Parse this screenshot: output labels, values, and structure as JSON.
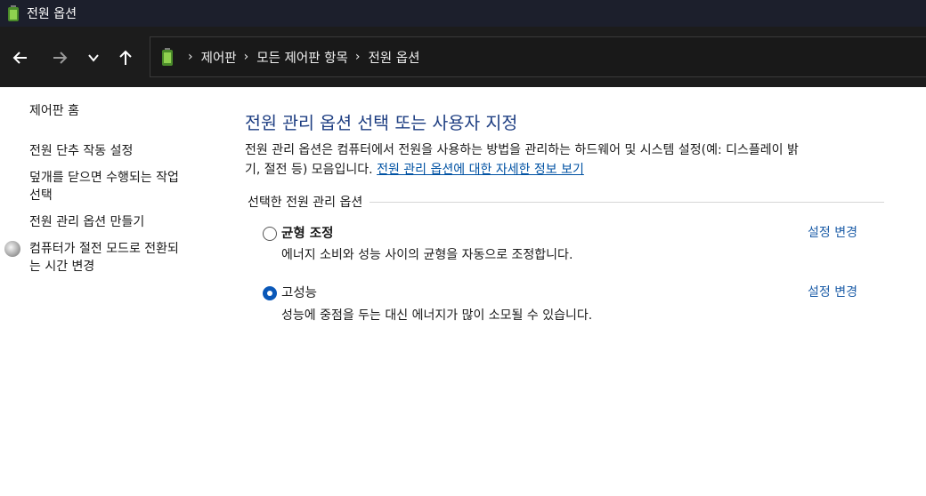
{
  "window": {
    "title": "전원 옵션",
    "icon": "battery-power-icon"
  },
  "nav": {
    "back": "back-arrow-icon",
    "forward": "forward-arrow-icon",
    "recent": "chevron-down-icon",
    "up": "up-arrow-icon"
  },
  "breadcrumb": {
    "sep": "›",
    "items": [
      "제어판",
      "모든 제어판 항목",
      "전원 옵션"
    ]
  },
  "sidebar": {
    "home": "제어판 홈",
    "links": [
      "전원 단추 작동 설정",
      "덮개를 닫으면 수행되는 작업",
      "선택",
      "전원 관리 옵션 만들기",
      "컴퓨터가 절전 모드로 전환되",
      "는 시간 변경"
    ]
  },
  "main": {
    "title": "전원 관리 옵션 선택 또는 사용자 지정",
    "description_line1": "전원 관리 옵션은 컴퓨터에서 전원을 사용하는 방법을 관리하는 하드웨어 및 시스템 설정(예: 디스플레이 밝",
    "description_line2": "기, 절전 등) 모음입니다. ",
    "description_link": "전원 관리 옵션에 대한 자세한 정보 보기",
    "section_label": "선택한 전원 관리 옵션",
    "plans": [
      {
        "name": "균형 조정",
        "description": "에너지 소비와 성능 사이의 균형을 자동으로 조정합니다.",
        "selected": false,
        "change": "설정 변경"
      },
      {
        "name": "고성능",
        "description": "성능에 중점을 두는 대신 에너지가 많이 소모될 수 있습니다.",
        "selected": true,
        "change": "설정 변경"
      }
    ]
  },
  "colors": {
    "accent": "#0a58b8",
    "title": "#1e3e82",
    "link": "#1e5ea8",
    "titlebar": "#1c1f2c"
  }
}
